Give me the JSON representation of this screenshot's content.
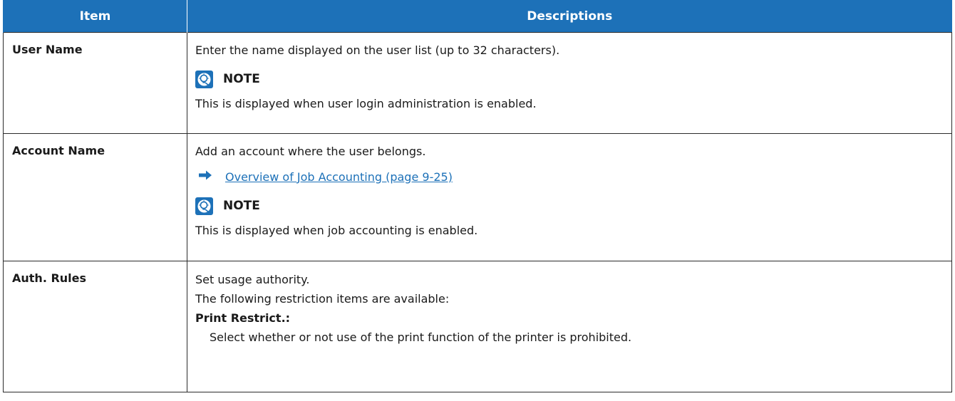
{
  "table": {
    "headers": {
      "item": "Item",
      "descriptions": "Descriptions"
    },
    "rows": {
      "user_name": {
        "item": "User Name",
        "desc": "Enter the name displayed on the user list (up to 32 characters).",
        "note_label": "NOTE",
        "note_text": "This is displayed when user login administration is enabled."
      },
      "account_name": {
        "item": "Account Name",
        "desc": "Add an account where the user belongs.",
        "link": "Overview of Job Accounting (page 9-25)",
        "note_label": "NOTE",
        "note_text": "This is displayed when job accounting is enabled."
      },
      "auth_rules": {
        "item": "Auth. Rules",
        "desc1": "Set usage authority.",
        "desc2": "The following restriction items are available:",
        "subhead": "Print Restrict.:",
        "subtext": "Select whether or not use of the print function of the printer is prohibited."
      }
    }
  },
  "colors": {
    "header_bg": "#1d71b8",
    "link": "#1d71b8",
    "border": "#2b2b2b"
  },
  "icons": {
    "note": "lightbulb-note-icon",
    "arrow": "arrow-right-icon"
  }
}
